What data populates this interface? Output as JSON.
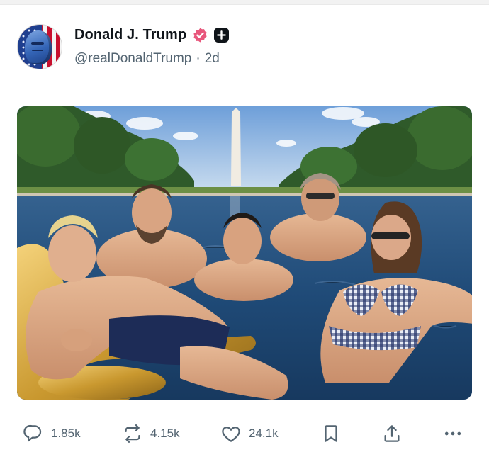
{
  "post": {
    "author": {
      "display_name": "Donald J. Trump",
      "handle": "@realDonaldTrump",
      "separator": "·",
      "time": "2d",
      "verified_color": "#e8577c",
      "avatar_icon": "american-flag-portrait"
    },
    "media": {
      "kind": "photo",
      "icon": "photo-reflecting-pool-swimmers"
    },
    "actions": {
      "replies": "1.85k",
      "reposts": "4.15k",
      "likes": "24.1k",
      "icons": [
        "reply-icon",
        "repost-icon",
        "like-icon",
        "bookmark-icon",
        "share-icon",
        "more-icon"
      ]
    }
  },
  "colors": {
    "text_primary": "#0f1419",
    "text_secondary": "#536471",
    "verified_badge": "#e8577c"
  }
}
